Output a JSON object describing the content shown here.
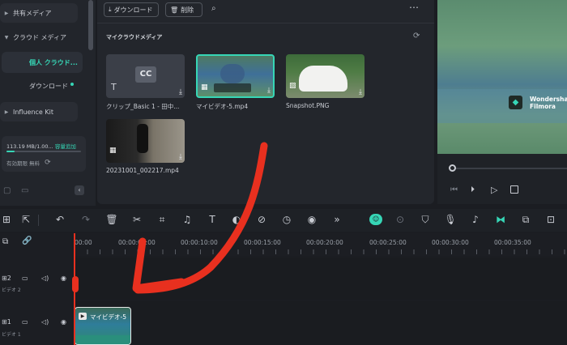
{
  "sidebar": {
    "shared_media": "共有メディア",
    "cloud_media": "クラウド メディア",
    "personal_cloud": "個人 クラウド...",
    "download": "ダウンロード",
    "influence_kit": "Influence Kit",
    "storage_text": "113.19 MB/1.00...",
    "storage_expand": "容量追加",
    "expiry": "有効期限 無料",
    "storage_fraction": 0.11
  },
  "media": {
    "download_button": "ダウンロード",
    "delete_button": "削除",
    "section_title": "マイクラウドメディア",
    "items": [
      {
        "name": "クリップ_Basic 1 - 田中...",
        "thumb_text": "CC"
      },
      {
        "name": "マイビデオ-5.mp4"
      },
      {
        "name": "Snapshot.PNG"
      },
      {
        "name": "20231001_002217.mp4"
      }
    ]
  },
  "preview": {
    "watermark_line1": "Wondershare",
    "watermark_line2": "Filmora"
  },
  "timeline": {
    "ticks": [
      "00:00",
      "00:00:05:00",
      "00:00:10:00",
      "00:00:15:00",
      "00:00:20:00",
      "00:00:25:00",
      "00:00:30:00",
      "00:00:35:00"
    ],
    "tracks": [
      {
        "number": "2",
        "label": "ビデオ 2"
      },
      {
        "number": "1",
        "label": "ビデオ 1"
      }
    ],
    "clip_label": "マイビデオ-5"
  },
  "colors": {
    "accent": "#36d6b6",
    "annotation": "#e8301f"
  }
}
